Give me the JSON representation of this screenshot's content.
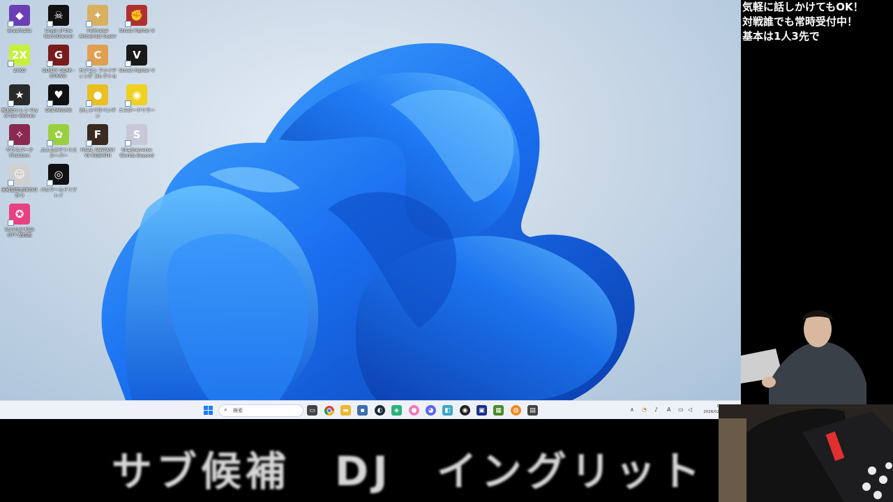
{
  "desktop": {
    "icons": [
      {
        "label": "Brawlhalla",
        "color": "#6a3fb5",
        "glyph": "◆"
      },
      {
        "label": "Crypt of the NecroDancer",
        "color": "#111111",
        "glyph": "☠"
      },
      {
        "label": "Fullmetal Alchemist Super Warriors",
        "color": "#d8b060",
        "glyph": "✦"
      },
      {
        "label": "Street Fighter 6",
        "color": "#b03030",
        "glyph": "✊"
      },
      {
        "label": "2XKO",
        "color": "#c6f03c",
        "glyph": "2X"
      },
      {
        "label": "GUILTY GEAR -STRIVE-",
        "color": "#7a1a1a",
        "glyph": "G"
      },
      {
        "label": "カプコン ファイティング コレクション",
        "color": "#e0a050",
        "glyph": "C"
      },
      {
        "label": "Street Fighter V",
        "color": "#1a1a1a",
        "glyph": "V"
      },
      {
        "label": "風来のシレン Cry of the Wolves",
        "color": "#2a2a2a",
        "glyph": "★"
      },
      {
        "label": "DELTARUNE",
        "color": "#111111",
        "glyph": "♥"
      },
      {
        "label": "おしゃべりペンギン",
        "color": "#e8c020",
        "glyph": "●"
      },
      {
        "label": "ミスタードリラー",
        "color": "#f0d020",
        "glyph": "◉"
      },
      {
        "label": "サウスパーク Phantom Breaker",
        "color": "#8a2a50",
        "glyph": "✧"
      },
      {
        "label": "ぷよぷよテトリス スーパー",
        "color": "#9ad040",
        "glyph": "✿"
      },
      {
        "label": "FINAL FANTASY VII REBIRTH",
        "color": "#3a2a20",
        "glyph": "F"
      },
      {
        "label": "Shadowverse Worlds Beyond",
        "color": "#c8c8d8",
        "glyph": "S"
      },
      {
        "label": "未確認生命体のひみつ",
        "color": "#d0d0d0",
        "glyph": "☺"
      },
      {
        "label": "パルワールドリプレイ",
        "color": "#111111",
        "glyph": "◎"
      },
      {
        "label": "Survival Kids OTY 配信用",
        "color": "#e84080",
        "glyph": "✪"
      }
    ]
  },
  "taskbar": {
    "search_placeholder": "検索",
    "apps": [
      "windows-start",
      "task-view",
      "chrome",
      "file-explorer",
      "store",
      "steam",
      "app-green",
      "app-pink",
      "discord",
      "app-teal",
      "obs",
      "app-blue",
      "minecraft",
      "app-orange",
      "app-gray"
    ],
    "clock_time": "0:27",
    "clock_date": "2026/02/17",
    "ime_indicator": "A"
  },
  "overlay": {
    "messages": [
      "気軽に話しかけてもOK！",
      "対戦誰でも常時受付中！",
      "基本は1人3先で"
    ],
    "caption": "サブ候補　DJ　イングリット"
  },
  "colors": {
    "accent": "#1a7cff",
    "taskbar": "#eef2f8"
  }
}
